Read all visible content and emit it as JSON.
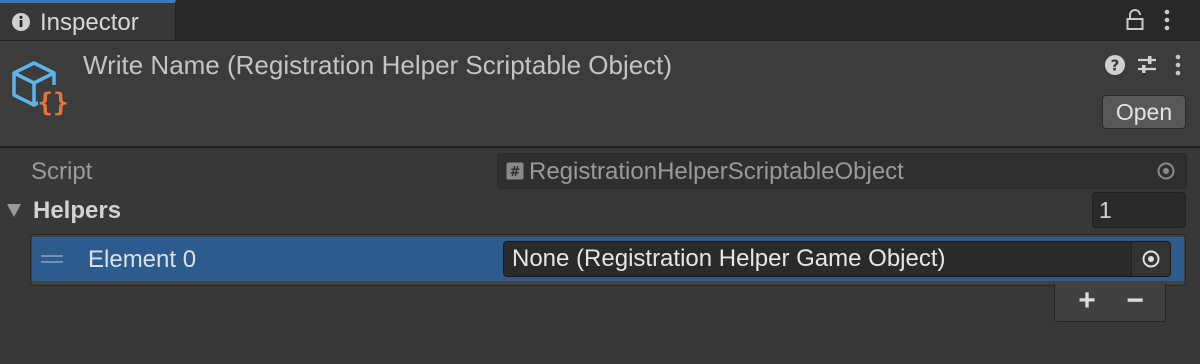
{
  "tab": {
    "title": "Inspector",
    "icon": "info-icon",
    "actions": [
      "lock-icon",
      "kebab-menu-icon"
    ]
  },
  "header": {
    "title": "Write Name (Registration Helper Scriptable Object)",
    "asset_icon": "scriptable-object-icon",
    "actions": [
      "help-icon",
      "preset-icon",
      "kebab-menu-icon"
    ],
    "open_label": "Open"
  },
  "script": {
    "label": "Script",
    "value": "RegistrationHelperScriptableObject",
    "icon": "script-file-icon"
  },
  "helpers": {
    "label": "Helpers",
    "size": "1",
    "elements": [
      {
        "label": "Element 0",
        "value": "None (Registration Helper Game Object)"
      }
    ],
    "add_label": "+",
    "remove_label": "−"
  },
  "colors": {
    "background": "#383838",
    "tab_bar": "#282828",
    "tab_accent": "#3a79bb",
    "selection": "#2d5b8d",
    "icon_blue": "#5fb3e8",
    "icon_orange": "#e8743b"
  }
}
